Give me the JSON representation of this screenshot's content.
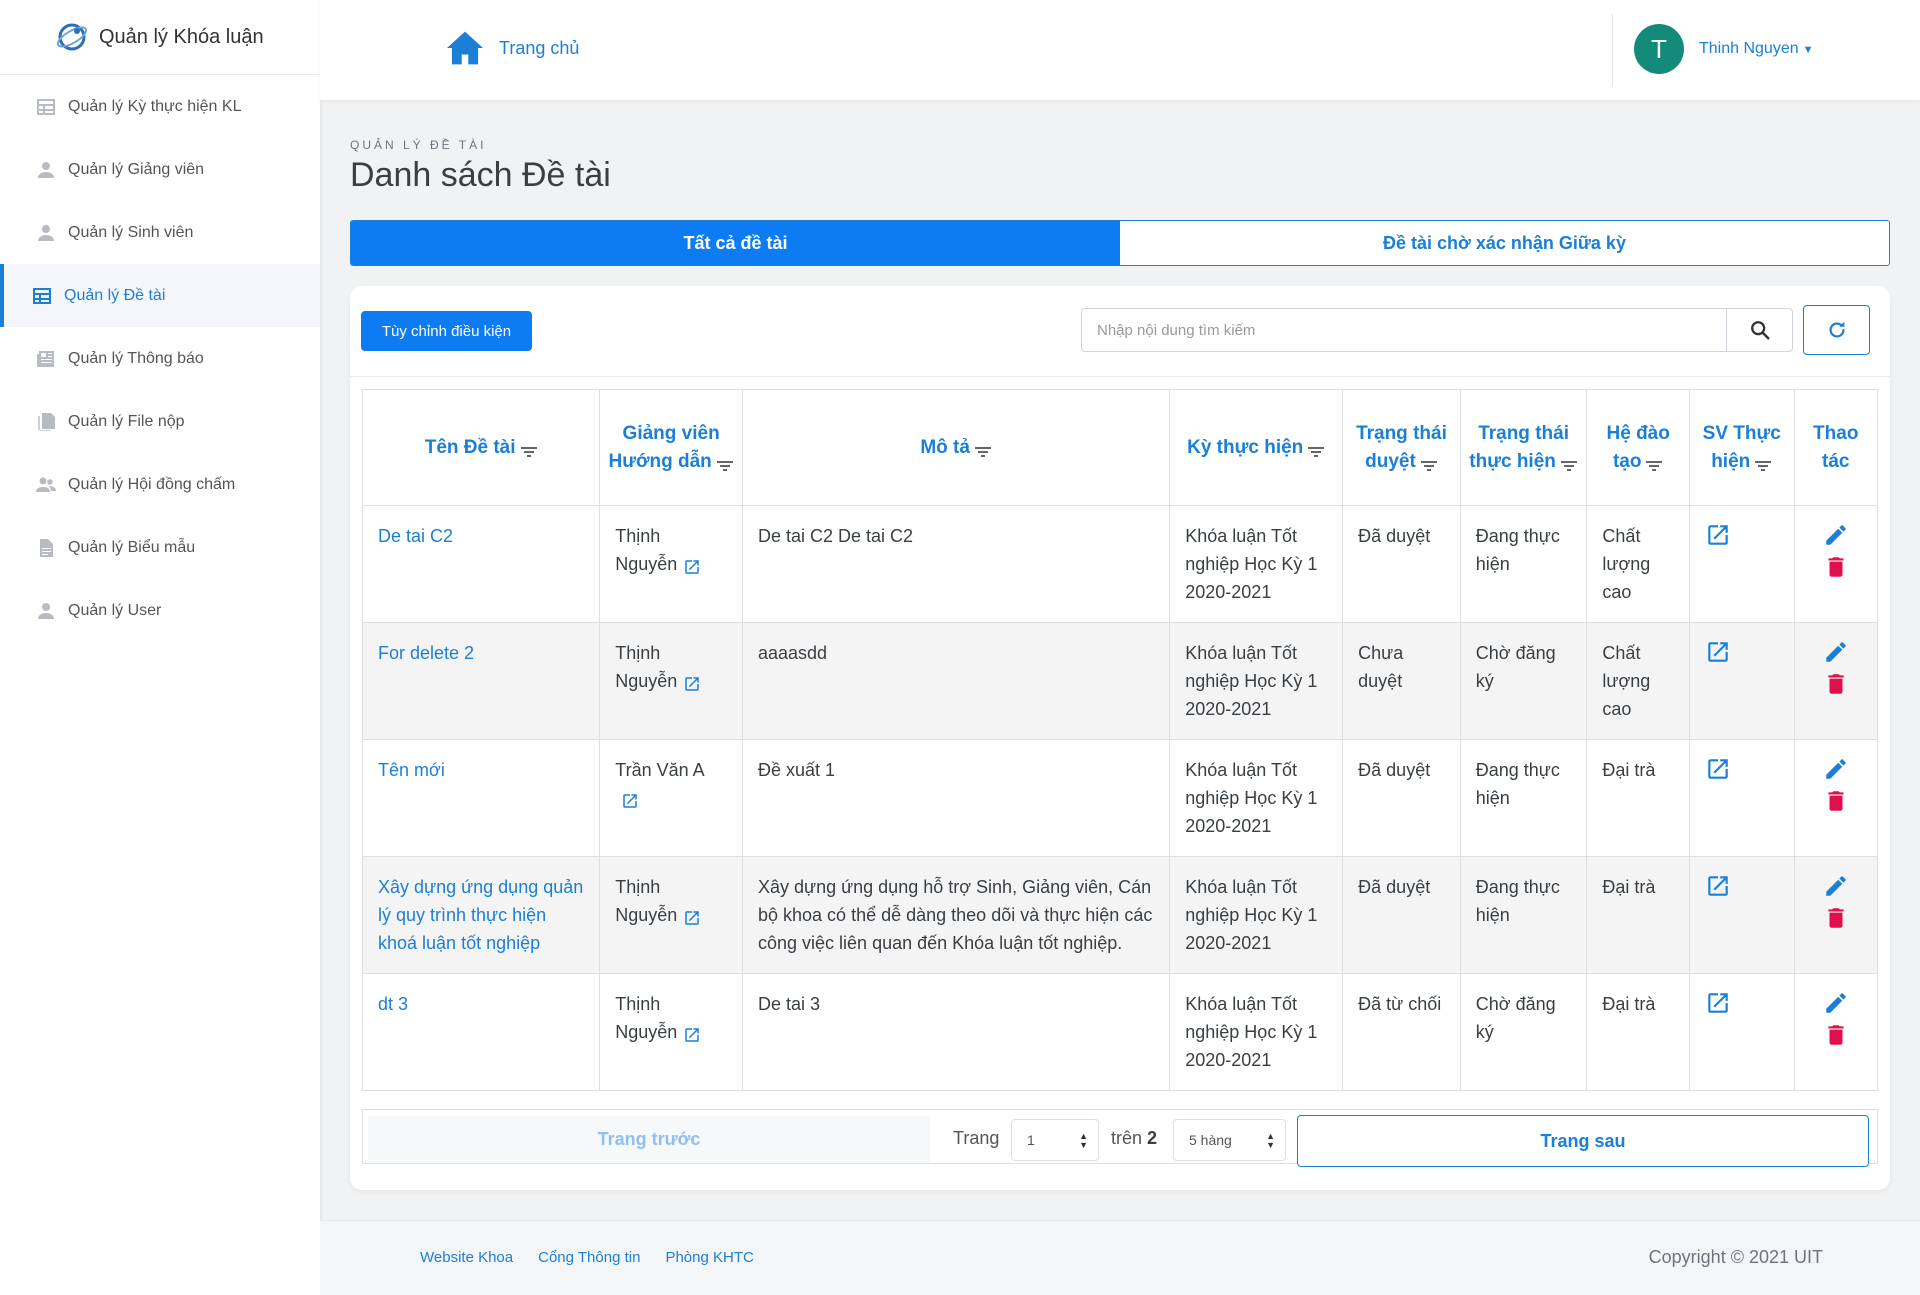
{
  "app": {
    "title": "Quản lý Khóa luận"
  },
  "sidebar": {
    "items": [
      {
        "label": "Quản lý Kỳ thực hiện KL",
        "icon": "table-icon"
      },
      {
        "label": "Quản lý Giảng viên",
        "icon": "person-icon"
      },
      {
        "label": "Quản lý Sinh viên",
        "icon": "person-icon"
      },
      {
        "label": "Quản lý Đề tài",
        "icon": "table-icon",
        "active": true
      },
      {
        "label": "Quản lý Thông báo",
        "icon": "newspaper-icon"
      },
      {
        "label": "Quản lý File nộp",
        "icon": "files-icon"
      },
      {
        "label": "Quản lý Hội đồng chấm",
        "icon": "group-icon"
      },
      {
        "label": "Quản lý Biểu mẫu",
        "icon": "document-icon"
      },
      {
        "label": "Quản lý User",
        "icon": "person-icon"
      }
    ]
  },
  "header": {
    "home_label": "Trang chủ",
    "user_initial": "T",
    "user_name": "Thinh Nguyen"
  },
  "page": {
    "breadcrumb": "QUẢN LÝ ĐỀ TÀI",
    "title": "Danh sách Đề tài"
  },
  "tabs": [
    {
      "label": "Tất cả đề tài",
      "active": true
    },
    {
      "label": "Đề tài chờ xác nhận Giữa kỳ",
      "active": false
    }
  ],
  "toolbar": {
    "filter_label": "Tùy chỉnh điều kiện",
    "search_placeholder": "Nhập nội dung tìm kiếm"
  },
  "table": {
    "columns": [
      "Tên Đề tài",
      "Giảng viên Hướng dẫn",
      "Mô tả",
      "Kỳ thực hiện",
      "Trạng thái duyệt",
      "Trạng thái thực hiện",
      "Hệ đào tạo",
      "SV Thực hiện",
      "Thao tác"
    ],
    "rows": [
      {
        "title": "De tai C2",
        "advisor": "Thịnh Nguyễn",
        "description": "De tai C2 De tai C2",
        "term": "Khóa luận Tốt nghiệp Học Kỳ 1 2020-2021",
        "approval": "Đã duyệt",
        "progress": "Đang thực hiện",
        "program": "Chất lượng cao"
      },
      {
        "title": "For delete 2",
        "advisor": "Thịnh Nguyễn",
        "description": "aaaasdd",
        "term": "Khóa luận Tốt nghiệp Học Kỳ 1 2020-2021",
        "approval": "Chưa duyệt",
        "progress": "Chờ đăng ký",
        "program": "Chất lượng cao"
      },
      {
        "title": "Tên mới",
        "advisor": "Trần Văn A",
        "description": "Đề xuất 1",
        "term": "Khóa luận Tốt nghiệp Học Kỳ 1 2020-2021",
        "approval": "Đã duyệt",
        "progress": "Đang thực hiện",
        "program": "Đại trà"
      },
      {
        "title": "Xây dựng ứng dụng quản lý quy trình thực hiện khoá luận tốt nghiệp",
        "advisor": "Thịnh Nguyễn",
        "description": "Xây dựng ứng dụng hỗ trợ Sinh, Giảng viên, Cán bộ khoa có thể dễ dàng theo dõi và thực hiện các công việc liên quan đến Khóa luận tốt nghiệp.",
        "term": "Khóa luận Tốt nghiệp Học Kỳ 1 2020-2021",
        "approval": "Đã duyệt",
        "progress": "Đang thực hiện",
        "program": "Đại trà"
      },
      {
        "title": "dt 3",
        "advisor": "Thịnh Nguyễn",
        "description": "De tai 3",
        "term": "Khóa luận Tốt nghiệp Học Kỳ 1 2020-2021",
        "approval": "Đã từ chối",
        "progress": "Chờ đăng ký",
        "program": "Đại trà"
      }
    ]
  },
  "pagination": {
    "prev_label": "Trang trước",
    "page_label": "Trang",
    "current_page": "1",
    "of_label": "trên",
    "total_pages": "2",
    "rows_option": "5 hàng",
    "next_label": "Trang sau"
  },
  "footer": {
    "links": [
      "Website Khoa",
      "Cổng Thông tin",
      "Phòng KHTC"
    ],
    "copyright": "Copyright © 2021 UIT"
  },
  "colors": {
    "primary": "#0d7cf2",
    "link": "#1b7fd6",
    "danger": "#e0104c",
    "avatar": "#148a7a"
  }
}
